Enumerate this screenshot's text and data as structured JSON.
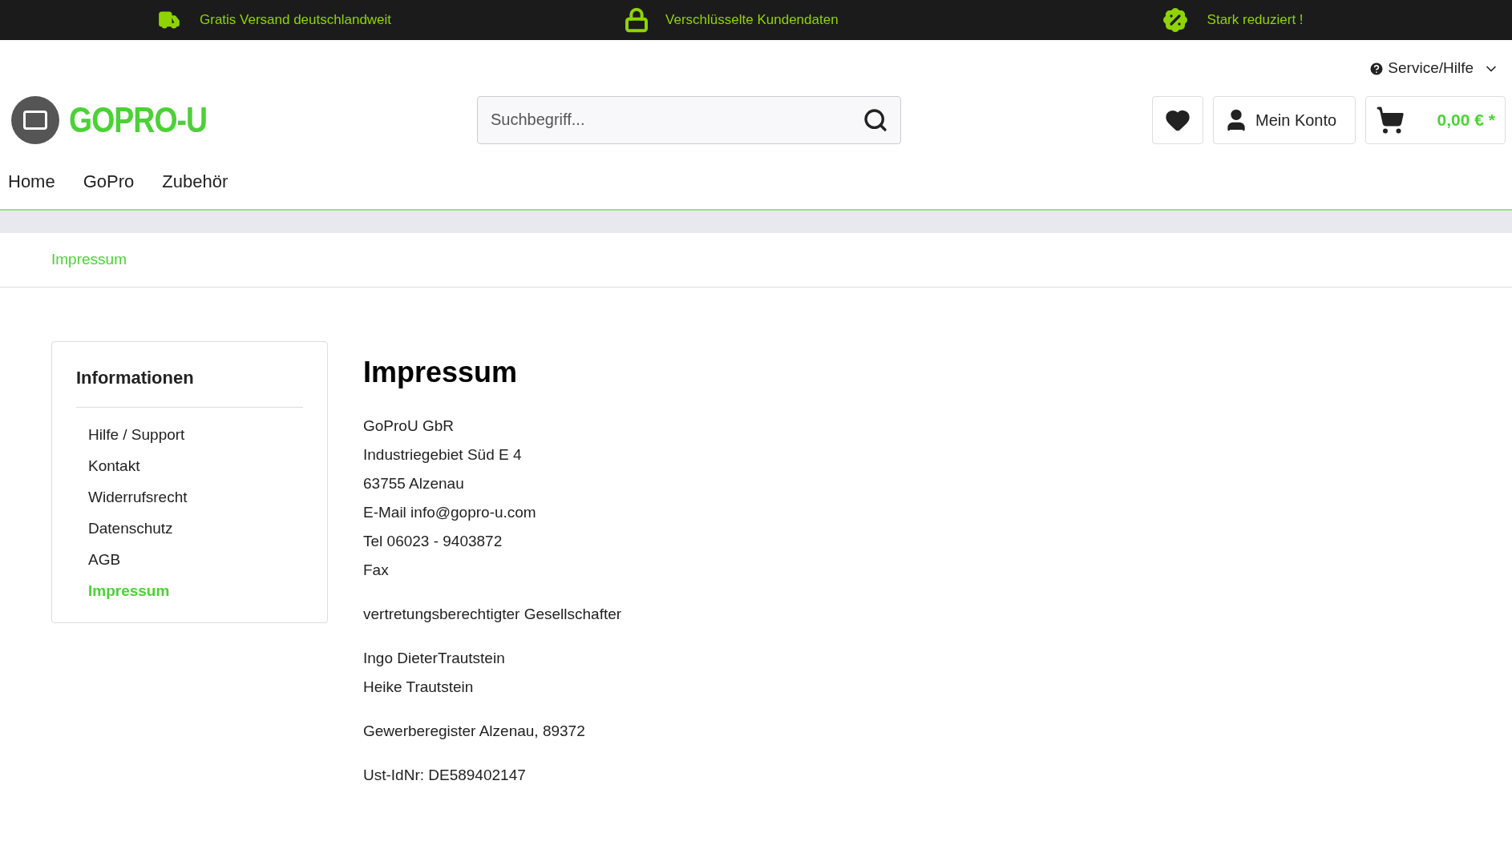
{
  "top_bar": [
    {
      "kind": "truck",
      "text": "Gratis Versand deutschlandweit"
    },
    {
      "kind": "lock",
      "text": "Verschlüsselte Kundendaten"
    },
    {
      "kind": "percent",
      "text": "Stark reduziert !"
    }
  ],
  "service_menu": "Service/Hilfe",
  "logo": "GOPRO-U",
  "search": {
    "placeholder": "Suchbegriff..."
  },
  "account": "Mein Konto",
  "cart": "0,00 € *",
  "nav": [
    "Home",
    "GoPro",
    "Zubehör"
  ],
  "breadcrumb": "Impressum",
  "sidebar": {
    "title": "Informationen",
    "items": [
      {
        "label": "Hilfe / Support",
        "selected": false
      },
      {
        "label": "Kontakt",
        "selected": false
      },
      {
        "label": "Widerrufsrecht",
        "selected": false
      },
      {
        "label": "Datenschutz",
        "selected": false
      },
      {
        "label": "AGB",
        "selected": false
      },
      {
        "label": "Impressum",
        "selected": true
      }
    ]
  },
  "content": {
    "title": "Impressum",
    "paragraphs": [
      [
        "GoProU GbR",
        "Industriegebiet Süd E 4",
        "63755 Alzenau",
        "E-Mail info@gopro-u.com",
        "Tel 06023 - 9403872",
        "Fax"
      ],
      [
        "vertretungsberechtigter Gesellschafter"
      ],
      [
        "Ingo DieterTrautstein",
        "Heike Trautstein"
      ],
      [
        "Gewerberegister Alzenau, 89372"
      ],
      [
        "Ust-IdNr: DE589402147"
      ]
    ]
  }
}
